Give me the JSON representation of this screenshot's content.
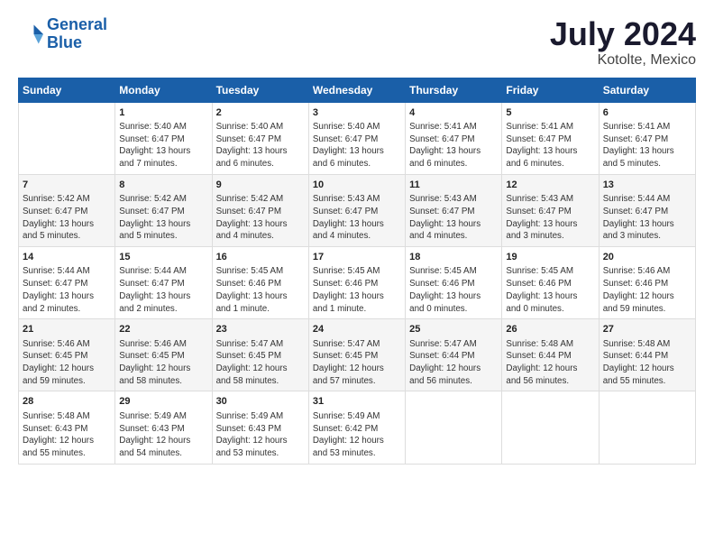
{
  "logo": {
    "line1": "General",
    "line2": "Blue"
  },
  "title": "July 2024",
  "subtitle": "Kotolte, Mexico",
  "days_header": [
    "Sunday",
    "Monday",
    "Tuesday",
    "Wednesday",
    "Thursday",
    "Friday",
    "Saturday"
  ],
  "weeks": [
    [
      {
        "day": "",
        "info": ""
      },
      {
        "day": "1",
        "info": "Sunrise: 5:40 AM\nSunset: 6:47 PM\nDaylight: 13 hours\nand 7 minutes."
      },
      {
        "day": "2",
        "info": "Sunrise: 5:40 AM\nSunset: 6:47 PM\nDaylight: 13 hours\nand 6 minutes."
      },
      {
        "day": "3",
        "info": "Sunrise: 5:40 AM\nSunset: 6:47 PM\nDaylight: 13 hours\nand 6 minutes."
      },
      {
        "day": "4",
        "info": "Sunrise: 5:41 AM\nSunset: 6:47 PM\nDaylight: 13 hours\nand 6 minutes."
      },
      {
        "day": "5",
        "info": "Sunrise: 5:41 AM\nSunset: 6:47 PM\nDaylight: 13 hours\nand 6 minutes."
      },
      {
        "day": "6",
        "info": "Sunrise: 5:41 AM\nSunset: 6:47 PM\nDaylight: 13 hours\nand 5 minutes."
      }
    ],
    [
      {
        "day": "7",
        "info": "Sunrise: 5:42 AM\nSunset: 6:47 PM\nDaylight: 13 hours\nand 5 minutes."
      },
      {
        "day": "8",
        "info": "Sunrise: 5:42 AM\nSunset: 6:47 PM\nDaylight: 13 hours\nand 5 minutes."
      },
      {
        "day": "9",
        "info": "Sunrise: 5:42 AM\nSunset: 6:47 PM\nDaylight: 13 hours\nand 4 minutes."
      },
      {
        "day": "10",
        "info": "Sunrise: 5:43 AM\nSunset: 6:47 PM\nDaylight: 13 hours\nand 4 minutes."
      },
      {
        "day": "11",
        "info": "Sunrise: 5:43 AM\nSunset: 6:47 PM\nDaylight: 13 hours\nand 4 minutes."
      },
      {
        "day": "12",
        "info": "Sunrise: 5:43 AM\nSunset: 6:47 PM\nDaylight: 13 hours\nand 3 minutes."
      },
      {
        "day": "13",
        "info": "Sunrise: 5:44 AM\nSunset: 6:47 PM\nDaylight: 13 hours\nand 3 minutes."
      }
    ],
    [
      {
        "day": "14",
        "info": "Sunrise: 5:44 AM\nSunset: 6:47 PM\nDaylight: 13 hours\nand 2 minutes."
      },
      {
        "day": "15",
        "info": "Sunrise: 5:44 AM\nSunset: 6:47 PM\nDaylight: 13 hours\nand 2 minutes."
      },
      {
        "day": "16",
        "info": "Sunrise: 5:45 AM\nSunset: 6:46 PM\nDaylight: 13 hours\nand 1 minute."
      },
      {
        "day": "17",
        "info": "Sunrise: 5:45 AM\nSunset: 6:46 PM\nDaylight: 13 hours\nand 1 minute."
      },
      {
        "day": "18",
        "info": "Sunrise: 5:45 AM\nSunset: 6:46 PM\nDaylight: 13 hours\nand 0 minutes."
      },
      {
        "day": "19",
        "info": "Sunrise: 5:45 AM\nSunset: 6:46 PM\nDaylight: 13 hours\nand 0 minutes."
      },
      {
        "day": "20",
        "info": "Sunrise: 5:46 AM\nSunset: 6:46 PM\nDaylight: 12 hours\nand 59 minutes."
      }
    ],
    [
      {
        "day": "21",
        "info": "Sunrise: 5:46 AM\nSunset: 6:45 PM\nDaylight: 12 hours\nand 59 minutes."
      },
      {
        "day": "22",
        "info": "Sunrise: 5:46 AM\nSunset: 6:45 PM\nDaylight: 12 hours\nand 58 minutes."
      },
      {
        "day": "23",
        "info": "Sunrise: 5:47 AM\nSunset: 6:45 PM\nDaylight: 12 hours\nand 58 minutes."
      },
      {
        "day": "24",
        "info": "Sunrise: 5:47 AM\nSunset: 6:45 PM\nDaylight: 12 hours\nand 57 minutes."
      },
      {
        "day": "25",
        "info": "Sunrise: 5:47 AM\nSunset: 6:44 PM\nDaylight: 12 hours\nand 56 minutes."
      },
      {
        "day": "26",
        "info": "Sunrise: 5:48 AM\nSunset: 6:44 PM\nDaylight: 12 hours\nand 56 minutes."
      },
      {
        "day": "27",
        "info": "Sunrise: 5:48 AM\nSunset: 6:44 PM\nDaylight: 12 hours\nand 55 minutes."
      }
    ],
    [
      {
        "day": "28",
        "info": "Sunrise: 5:48 AM\nSunset: 6:43 PM\nDaylight: 12 hours\nand 55 minutes."
      },
      {
        "day": "29",
        "info": "Sunrise: 5:49 AM\nSunset: 6:43 PM\nDaylight: 12 hours\nand 54 minutes."
      },
      {
        "day": "30",
        "info": "Sunrise: 5:49 AM\nSunset: 6:43 PM\nDaylight: 12 hours\nand 53 minutes."
      },
      {
        "day": "31",
        "info": "Sunrise: 5:49 AM\nSunset: 6:42 PM\nDaylight: 12 hours\nand 53 minutes."
      },
      {
        "day": "",
        "info": ""
      },
      {
        "day": "",
        "info": ""
      },
      {
        "day": "",
        "info": ""
      }
    ]
  ]
}
